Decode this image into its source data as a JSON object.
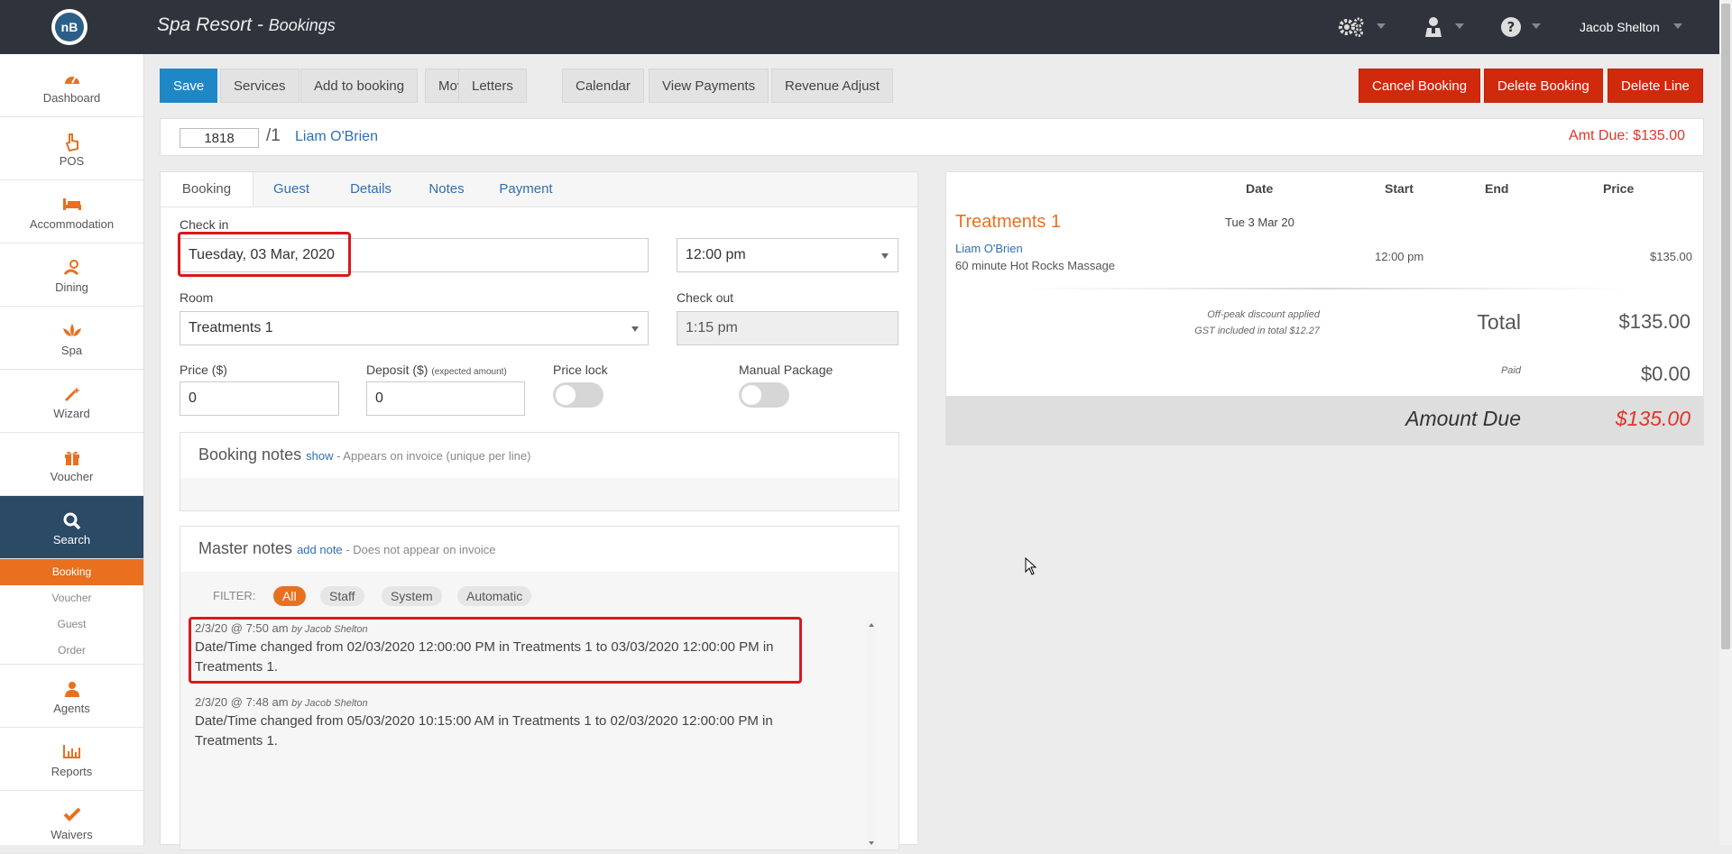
{
  "header": {
    "logo_text": "nB",
    "app_name": "Spa Resort - ",
    "section": "Bookings",
    "user_name": "Jacob Shelton",
    "icons": [
      "gears-icon",
      "agent-icon",
      "help-icon"
    ]
  },
  "sidebar": {
    "items": [
      {
        "label": "Dashboard",
        "icon": "dashboard-icon"
      },
      {
        "label": "POS",
        "icon": "pointer-hand-icon"
      },
      {
        "label": "Accommodation",
        "icon": "bed-icon"
      },
      {
        "label": "Dining",
        "icon": "dining-icon"
      },
      {
        "label": "Spa",
        "icon": "lotus-icon"
      },
      {
        "label": "Wizard",
        "icon": "magic-wand-icon"
      },
      {
        "label": "Voucher",
        "icon": "gift-icon"
      },
      {
        "label": "Search",
        "icon": "search-icon"
      },
      {
        "label": "Agents",
        "icon": "agent-icon"
      },
      {
        "label": "Reports",
        "icon": "chart-icon"
      },
      {
        "label": "Waivers",
        "icon": "check-icon"
      }
    ],
    "search_sub": [
      "Booking",
      "Voucher",
      "Guest",
      "Order"
    ]
  },
  "toolbar": {
    "save": "Save",
    "services": "Services",
    "add_to_booking": "Add to booking",
    "move": "Move",
    "letters": "Letters",
    "calendar": "Calendar",
    "view_payments": "View Payments",
    "revenue_adjust": "Revenue Adjust",
    "cancel_booking": "Cancel Booking",
    "delete_booking": "Delete Booking",
    "delete_line": "Delete Line"
  },
  "booking": {
    "number": "1818",
    "line": "/1",
    "guest": "Liam O'Brien",
    "amt_due": "Amt Due: $135.00"
  },
  "tabs": [
    "Booking",
    "Guest",
    "Details",
    "Notes",
    "Payment"
  ],
  "form": {
    "checkin_label": "Check in",
    "checkin_date": "Tuesday, 03 Mar, 2020",
    "checkin_time": "12:00 pm",
    "room_label": "Room",
    "room": "Treatments 1",
    "checkout_label": "Check out",
    "checkout_time": "1:15 pm",
    "price_label": "Price ($)",
    "price": "0",
    "deposit_label": "Deposit ($)",
    "deposit_hint": "(expected amount)",
    "deposit": "0",
    "price_lock_label": "Price lock",
    "manual_package_label": "Manual Package"
  },
  "booking_notes": {
    "title": "Booking notes",
    "link": "show",
    "hint": " - Appears on invoice (unique per line)"
  },
  "master_notes": {
    "title": "Master notes",
    "link": "add note",
    "hint": " - Does not appear on invoice",
    "filter_label": "FILTER:",
    "filters": [
      "All",
      "Staff",
      "System",
      "Automatic"
    ],
    "notes": [
      {
        "time": "2/3/20 @ 7:50 am",
        "by": "by Jacob Shelton",
        "text": "Date/Time changed from 02/03/2020 12:00:00 PM in Treatments 1 to 03/03/2020 12:00:00 PM in Treatments 1."
      },
      {
        "time": "2/3/20 @ 7:48 am",
        "by": "by Jacob Shelton",
        "text": "Date/Time changed from 05/03/2020 10:15:00 AM in Treatments 1 to 02/03/2020 12:00:00 PM in Treatments 1."
      }
    ]
  },
  "summary": {
    "columns": [
      "Date",
      "Start",
      "End",
      "Price"
    ],
    "room": "Treatments 1",
    "date": "Tue 3 Mar 20",
    "guest": "Liam O'Brien",
    "service": "60 minute Hot Rocks Massage",
    "start": "12:00 pm",
    "price": "$135.00",
    "discount_note": "Off-peak discount applied",
    "gst_note": "GST included in total $12.27",
    "total_label": "Total",
    "total": "$135.00",
    "paid_label": "Paid",
    "paid": "$0.00",
    "amount_due_label": "Amount Due",
    "amount_due": "$135.00"
  }
}
